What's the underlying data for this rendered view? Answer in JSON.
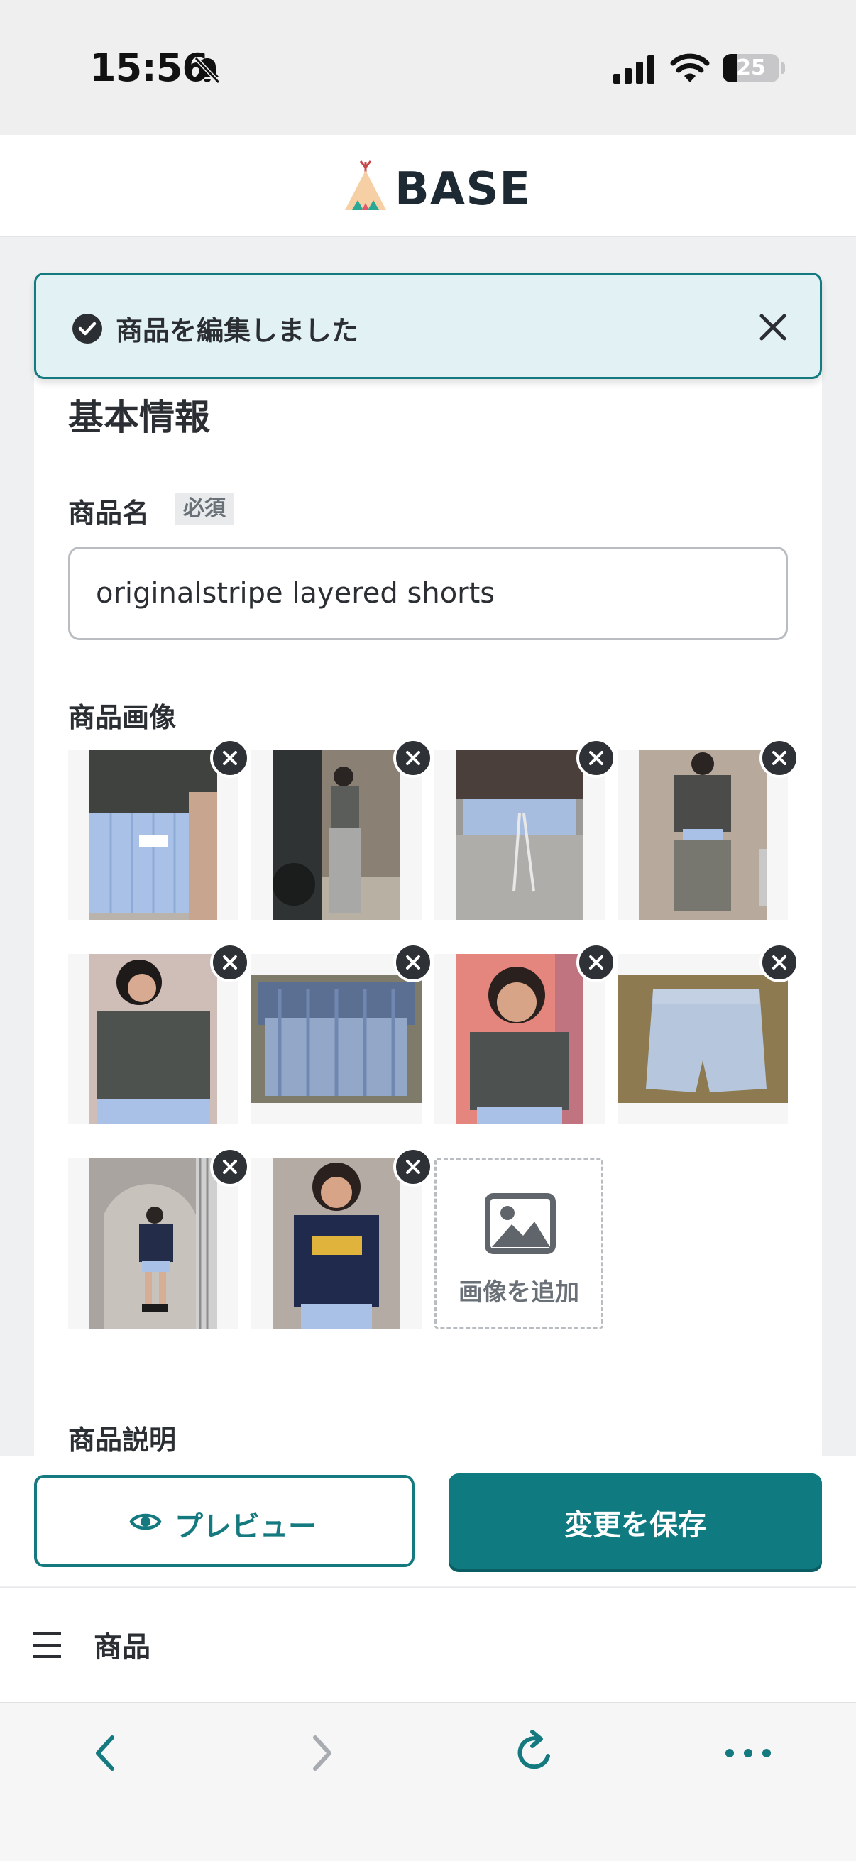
{
  "status_bar": {
    "time": "15:56",
    "battery": "25",
    "battery_level": 0.25
  },
  "header": {
    "brand": "BASE"
  },
  "toast": {
    "message": "商品を編集しました"
  },
  "form": {
    "section_title": "基本情報",
    "product_name_label": "商品名",
    "required_badge": "必須",
    "product_name_value": "originalstripe layered shorts",
    "images_label": "商品画像",
    "add_image_label": "画像を追加",
    "description_label": "商品説明",
    "images": [
      {
        "icon": "photo-shorts-closeup"
      },
      {
        "icon": "photo-full-body-car"
      },
      {
        "icon": "photo-waistband"
      },
      {
        "icon": "photo-full-body-gray"
      },
      {
        "icon": "photo-selfie-top"
      },
      {
        "icon": "photo-fabric-detail"
      },
      {
        "icon": "photo-selfie-pink"
      },
      {
        "icon": "photo-shorts-flat"
      },
      {
        "icon": "photo-mirror-navy"
      },
      {
        "icon": "photo-navy-sweatshirt"
      }
    ]
  },
  "actions": {
    "preview_label": "プレビュー",
    "save_label": "変更を保存"
  },
  "page_nav": {
    "label": "商品"
  },
  "colors": {
    "accent": "#0f7a80",
    "toast_bg": "#e2f2f4"
  }
}
